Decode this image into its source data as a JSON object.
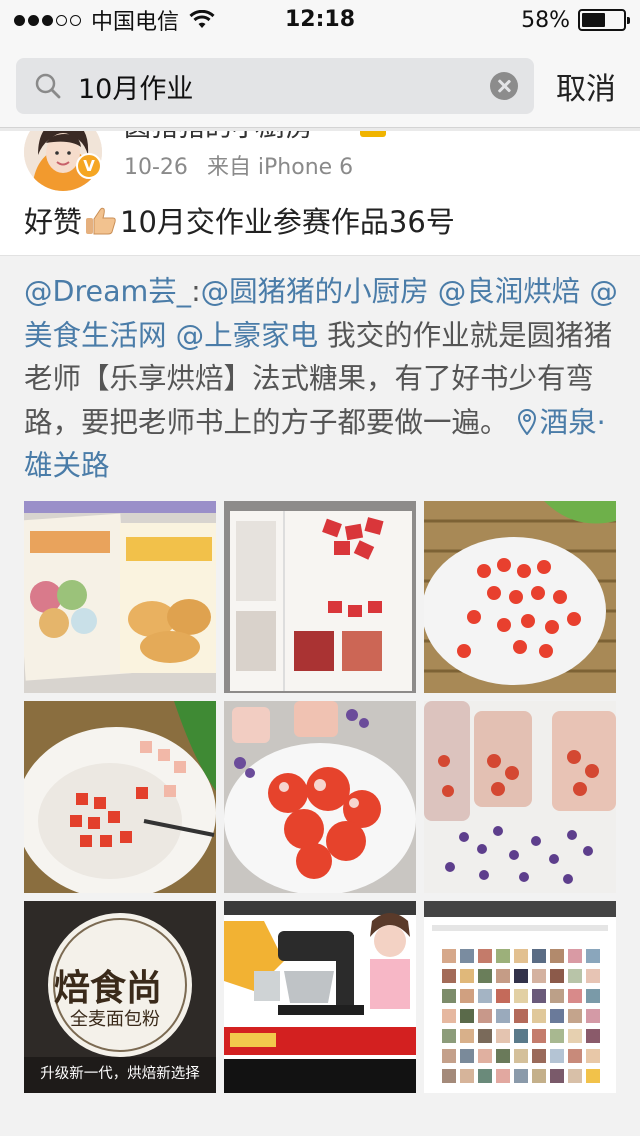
{
  "status_bar": {
    "carrier": "中国电信",
    "time": "12:18",
    "battery": "58%",
    "battery_level": 0.58,
    "signal_bars_filled": 3,
    "signal_bars_total": 5
  },
  "search": {
    "query": "10月作业",
    "cancel_label": "取消"
  },
  "post": {
    "user_name": "圆猪猪的小厨房",
    "time": "10-26",
    "source": "来自 iPhone 6",
    "text_before_icon": "好赞",
    "text_after_icon": "10月交作业参赛作品36号",
    "icons": [
      "thumbs-up-icon",
      "verified-icon",
      "vip-icon"
    ]
  },
  "repost": {
    "mention_1": "@Dream芸_",
    "colon": ":",
    "mention_2": "@圆猪猪的小厨房",
    "mention_3": "@良润烘焙",
    "mention_4": "@美食生活网",
    "mention_5": "@上豪家电",
    "body": " 我交的作业就是圆猪猪老师【乐享烘焙】法式糖果，有了好书少有弯路，要把老师书上的方子都要做一遍。",
    "location": "酒泉·雄关路"
  },
  "photo_grid": {
    "ad": {
      "title": "焙食尚",
      "subtitle": "全麦面包粉",
      "caption": "升级新一代，烘焙新选择"
    }
  },
  "colors": {
    "link": "#4a7ca8",
    "repost_bg": "#f2f2f2",
    "search_bg": "#e3e4e6",
    "verified": "#f5a623"
  }
}
